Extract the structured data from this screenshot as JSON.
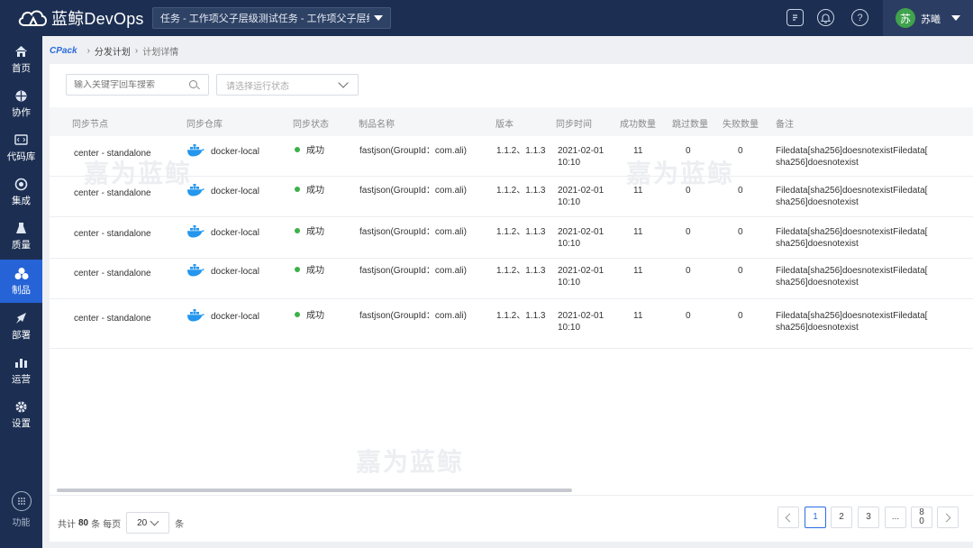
{
  "app": {
    "name": "蓝鲸DevOps"
  },
  "header": {
    "project_select": "任务 - 工作项父子层级测试任务 - 工作项父子层级测...",
    "user_avatar": "苏",
    "user_name": "苏曦"
  },
  "sidebar": {
    "items": [
      {
        "label": "首页",
        "icon": "home-icon"
      },
      {
        "label": "协作",
        "icon": "collaborate-icon"
      },
      {
        "label": "代码库",
        "icon": "code-repo-icon"
      },
      {
        "label": "集成",
        "icon": "integration-icon"
      },
      {
        "label": "质量",
        "icon": "quality-icon"
      },
      {
        "label": "制品",
        "icon": "artifact-icon"
      },
      {
        "label": "部署",
        "icon": "deploy-icon"
      },
      {
        "label": "运营",
        "icon": "operations-icon"
      },
      {
        "label": "设置",
        "icon": "settings-icon"
      }
    ],
    "active": "制品",
    "function_label": "功能"
  },
  "breadcrumb": {
    "logo": "CPack",
    "parent": "分发计划",
    "current": "计划详情"
  },
  "filters": {
    "search_placeholder": "输入关键字回车搜索",
    "status_placeholder": "请选择运行状态"
  },
  "table": {
    "columns": [
      "同步节点",
      "同步仓库",
      "同步状态",
      "制品名称",
      "版本",
      "同步时间",
      "成功数量",
      "跳过数量",
      "失败数量",
      "备注"
    ],
    "rows": [
      {
        "node": "center - standalone",
        "repo": "docker-local",
        "status": "成功",
        "artifact": "fastjson(GroupId：com.ali)",
        "version": "1.1.2、1.1.3",
        "time_date": "2021-02-01",
        "time_clock": "10:10",
        "success": "11",
        "skipped": "0",
        "failed": "0",
        "note_1": "Filedata[sha256]doesnotexistFiledata[",
        "note_2": "sha256]doesnotexist"
      },
      {
        "node": "center - standalone",
        "repo": "docker-local",
        "status": "成功",
        "artifact": "fastjson(GroupId：com.ali)",
        "version": "1.1.2、1.1.3",
        "time_date": "2021-02-01",
        "time_clock": "10:10",
        "success": "11",
        "skipped": "0",
        "failed": "0",
        "note_1": "Filedata[sha256]doesnotexistFiledata[",
        "note_2": "sha256]doesnotexist"
      },
      {
        "node": "center - standalone",
        "repo": "docker-local",
        "status": "成功",
        "artifact": "fastjson(GroupId：com.ali)",
        "version": "1.1.2、1.1.3",
        "time_date": "2021-02-01",
        "time_clock": "10:10",
        "success": "11",
        "skipped": "0",
        "failed": "0",
        "note_1": "Filedata[sha256]doesnotexistFiledata[",
        "note_2": "sha256]doesnotexist"
      },
      {
        "node": "center - standalone",
        "repo": "docker-local",
        "status": "成功",
        "artifact": "fastjson(GroupId：com.ali)",
        "version": "1.1.2、1.1.3",
        "time_date": "2021-02-01",
        "time_clock": "10:10",
        "success": "11",
        "skipped": "0",
        "failed": "0",
        "note_1": "Filedata[sha256]doesnotexistFiledata[",
        "note_2": "sha256]doesnotexist"
      },
      {
        "node": "center - standalone",
        "repo": "docker-local",
        "status": "成功",
        "artifact": "fastjson(GroupId：com.ali)",
        "version": "1.1.2、1.1.3",
        "time_date": "2021-02-01",
        "time_clock": "10:10",
        "success": "11",
        "skipped": "0",
        "failed": "0",
        "note_1": "Filedata[sha256]doesnotexistFiledata[",
        "note_2": "sha256]doesnotexist"
      }
    ]
  },
  "pagination": {
    "total_prefix": "共计",
    "total": "80",
    "total_unit": "条",
    "per_page_label": "每页",
    "page_size": "20",
    "page_size_unit": "条",
    "pages": [
      "1",
      "2",
      "3",
      "...",
      "80"
    ],
    "current_page": "1"
  },
  "watermark": "嘉为蓝鲸",
  "colors": {
    "topbar": "#1c2f52",
    "sidebar_active": "#2563d6",
    "accent": "#2b6de3",
    "success": "#3bb14a"
  }
}
